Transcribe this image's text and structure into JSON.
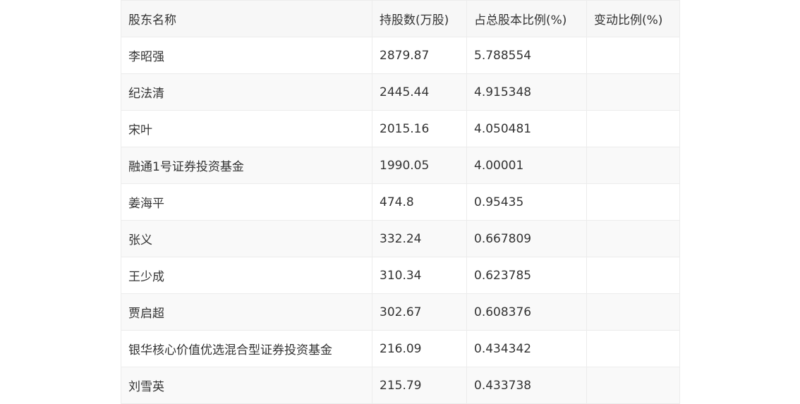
{
  "table": {
    "headers": [
      "股东名称",
      "持股数(万股)",
      "占总股本比例(%)",
      "变动比例(%)"
    ],
    "rows": [
      [
        "李昭强",
        "2879.87",
        "5.788554",
        ""
      ],
      [
        "纪法清",
        "2445.44",
        "4.915348",
        ""
      ],
      [
        "宋叶",
        "2015.16",
        "4.050481",
        ""
      ],
      [
        "融通1号证券投资基金",
        "1990.05",
        "4.00001",
        ""
      ],
      [
        "姜海平",
        "474.8",
        "0.95435",
        ""
      ],
      [
        "张义",
        "332.24",
        "0.667809",
        ""
      ],
      [
        "王少成",
        "310.34",
        "0.623785",
        ""
      ],
      [
        "贾启超",
        "302.67",
        "0.608376",
        ""
      ],
      [
        "银华核心价值优选混合型证券投资基金",
        "216.09",
        "0.434342",
        ""
      ],
      [
        "刘雪英",
        "215.79",
        "0.433738",
        ""
      ]
    ]
  }
}
